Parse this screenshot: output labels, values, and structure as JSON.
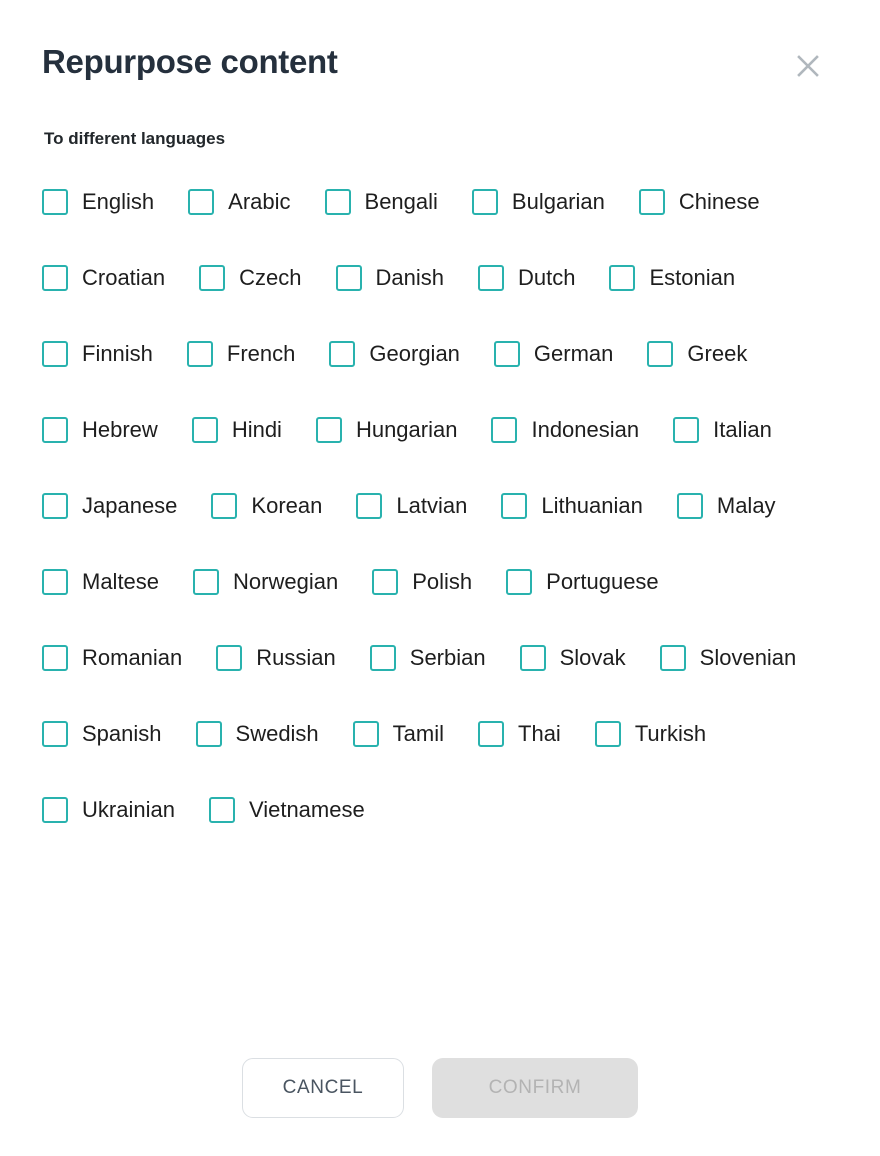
{
  "dialog": {
    "title": "Repurpose content",
    "close_icon": "close-icon",
    "section_label": "To different languages",
    "accent_color": "#29b2ae",
    "title_color": "#25303d"
  },
  "languages": [
    {
      "label": "English",
      "checked": false
    },
    {
      "label": "Arabic",
      "checked": false
    },
    {
      "label": "Bengali",
      "checked": false
    },
    {
      "label": "Bulgarian",
      "checked": false
    },
    {
      "label": "Chinese",
      "checked": false
    },
    {
      "label": "Croatian",
      "checked": false
    },
    {
      "label": "Czech",
      "checked": false
    },
    {
      "label": "Danish",
      "checked": false
    },
    {
      "label": "Dutch",
      "checked": false
    },
    {
      "label": "Estonian",
      "checked": false
    },
    {
      "label": "Finnish",
      "checked": false
    },
    {
      "label": "French",
      "checked": false
    },
    {
      "label": "Georgian",
      "checked": false
    },
    {
      "label": "German",
      "checked": false
    },
    {
      "label": "Greek",
      "checked": false
    },
    {
      "label": "Hebrew",
      "checked": false
    },
    {
      "label": "Hindi",
      "checked": false
    },
    {
      "label": "Hungarian",
      "checked": false
    },
    {
      "label": "Indonesian",
      "checked": false
    },
    {
      "label": "Italian",
      "checked": false
    },
    {
      "label": "Japanese",
      "checked": false
    },
    {
      "label": "Korean",
      "checked": false
    },
    {
      "label": "Latvian",
      "checked": false
    },
    {
      "label": "Lithuanian",
      "checked": false
    },
    {
      "label": "Malay",
      "checked": false
    },
    {
      "label": "Maltese",
      "checked": false
    },
    {
      "label": "Norwegian",
      "checked": false
    },
    {
      "label": "Polish",
      "checked": false
    },
    {
      "label": "Portuguese",
      "checked": false
    },
    {
      "label": "Romanian",
      "checked": false
    },
    {
      "label": "Russian",
      "checked": false
    },
    {
      "label": "Serbian",
      "checked": false
    },
    {
      "label": "Slovak",
      "checked": false
    },
    {
      "label": "Slovenian",
      "checked": false
    },
    {
      "label": "Spanish",
      "checked": false
    },
    {
      "label": "Swedish",
      "checked": false
    },
    {
      "label": "Tamil",
      "checked": false
    },
    {
      "label": "Thai",
      "checked": false
    },
    {
      "label": "Turkish",
      "checked": false
    },
    {
      "label": "Ukrainian",
      "checked": false
    },
    {
      "label": "Vietnamese",
      "checked": false
    }
  ],
  "footer": {
    "cancel_label": "CANCEL",
    "confirm_label": "CONFIRM",
    "confirm_disabled": true
  }
}
